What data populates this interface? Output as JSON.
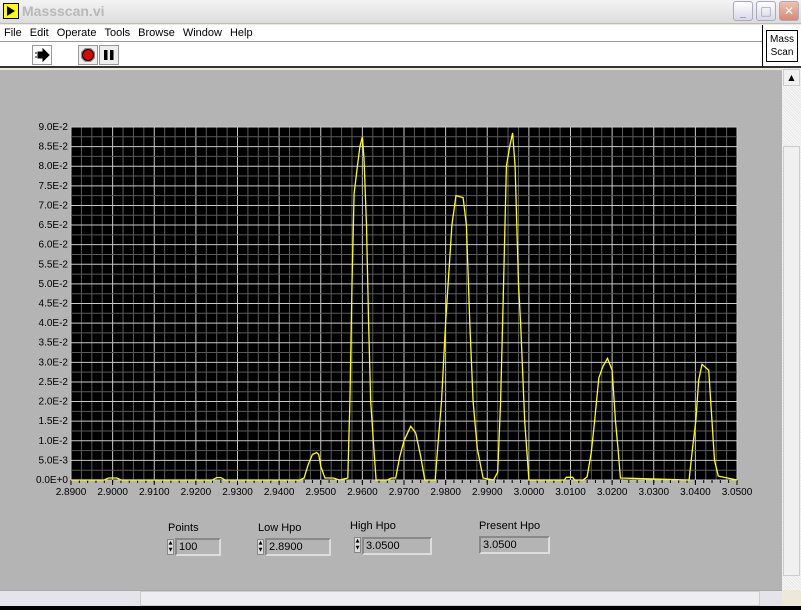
{
  "window": {
    "title": "Massscan.vi"
  },
  "menu": [
    "File",
    "Edit",
    "Operate",
    "Tools",
    "Browse",
    "Window",
    "Help"
  ],
  "toolbar": {
    "run_icon": "run-arrow-icon",
    "stop_icon": "abort-icon",
    "pause_icon": "pause-icon"
  },
  "vi_icon_label": [
    "Mass",
    "Scan"
  ],
  "controls": {
    "points": {
      "label": "Points",
      "value": "100"
    },
    "low_hpo": {
      "label": "Low Hpo",
      "value": "2.8900"
    },
    "high_hpo": {
      "label": "High Hpo",
      "value": "3.0500"
    },
    "present_hpo": {
      "label": "Present Hpo",
      "value": "3.0500"
    }
  },
  "colors": {
    "plot_bg": "#000000",
    "trace": "#ffff00",
    "panel": "#b4b4b4"
  },
  "chart_data": {
    "type": "line",
    "xlim": [
      2.89,
      3.05
    ],
    "ylim": [
      0,
      0.09
    ],
    "grid": true,
    "x_ticks": [
      "2.8900",
      "2.9000",
      "2.9100",
      "2.9200",
      "2.9300",
      "2.9400",
      "2.9500",
      "2.9600",
      "2.9700",
      "2.9800",
      "2.9900",
      "3.0000",
      "3.0100",
      "3.0200",
      "3.0300",
      "3.0400",
      "3.0500"
    ],
    "y_ticks": [
      "0.0E+0",
      "5.0E-3",
      "1.0E-2",
      "1.5E-2",
      "2.0E-2",
      "2.5E-2",
      "3.0E-2",
      "3.5E-2",
      "4.0E-2",
      "4.5E-2",
      "5.0E-2",
      "5.5E-2",
      "6.0E-2",
      "6.5E-2",
      "7.0E-2",
      "7.5E-2",
      "8.0E-2",
      "8.5E-2",
      "9.0E-2"
    ],
    "points": [
      [
        2.89,
        0
      ],
      [
        2.898,
        0
      ],
      [
        2.899,
        0.0005
      ],
      [
        2.901,
        0.0005
      ],
      [
        2.902,
        0
      ],
      [
        2.924,
        0
      ],
      [
        2.925,
        0.0006
      ],
      [
        2.926,
        0.0006
      ],
      [
        2.927,
        0
      ],
      [
        2.945,
        0
      ],
      [
        2.946,
        0.0005
      ],
      [
        2.947,
        0.004
      ],
      [
        2.948,
        0.0065
      ],
      [
        2.949,
        0.007
      ],
      [
        2.9495,
        0.0065
      ],
      [
        2.95,
        0.0035
      ],
      [
        2.951,
        0.0005
      ],
      [
        2.953,
        0.0005
      ],
      [
        2.9545,
        0
      ],
      [
        2.9565,
        0.0005
      ],
      [
        2.957,
        0.02
      ],
      [
        2.9575,
        0.05
      ],
      [
        2.958,
        0.073
      ],
      [
        2.9588,
        0.08
      ],
      [
        2.9594,
        0.085
      ],
      [
        2.96,
        0.0875
      ],
      [
        2.9604,
        0.082
      ],
      [
        2.961,
        0.065
      ],
      [
        2.9615,
        0.04
      ],
      [
        2.962,
        0.02
      ],
      [
        2.9628,
        0.0075
      ],
      [
        2.9633,
        0
      ],
      [
        2.966,
        0
      ],
      [
        2.967,
        0.0005
      ],
      [
        2.968,
        0.0005
      ],
      [
        2.969,
        0.006
      ],
      [
        2.97,
        0.01
      ],
      [
        2.9716,
        0.0137
      ],
      [
        2.9728,
        0.012
      ],
      [
        2.974,
        0.006
      ],
      [
        2.975,
        0
      ],
      [
        2.9775,
        0
      ],
      [
        2.978,
        0.007
      ],
      [
        2.979,
        0.02
      ],
      [
        2.98,
        0.04
      ],
      [
        2.9815,
        0.065
      ],
      [
        2.9825,
        0.0725
      ],
      [
        2.9842,
        0.072
      ],
      [
        2.985,
        0.065
      ],
      [
        2.9858,
        0.04
      ],
      [
        2.9866,
        0.02
      ],
      [
        2.9876,
        0.008
      ],
      [
        2.989,
        0.0005
      ],
      [
        2.9915,
        0
      ],
      [
        2.9925,
        0.002
      ],
      [
        2.9932,
        0.02
      ],
      [
        2.9938,
        0.045
      ],
      [
        2.9946,
        0.08
      ],
      [
        2.9954,
        0.085
      ],
      [
        2.9961,
        0.0885
      ],
      [
        2.9967,
        0.08
      ],
      [
        2.9975,
        0.05
      ],
      [
        2.998,
        0.04
      ],
      [
        2.999,
        0.015
      ],
      [
        3.0,
        0
      ],
      [
        3.0085,
        0
      ],
      [
        3.009,
        0.0007
      ],
      [
        3.0105,
        0.0007
      ],
      [
        3.011,
        0
      ],
      [
        3.013,
        0
      ],
      [
        3.014,
        0.0008
      ],
      [
        3.015,
        0.007
      ],
      [
        3.0158,
        0.015
      ],
      [
        3.0168,
        0.026
      ],
      [
        3.0178,
        0.029
      ],
      [
        3.0189,
        0.031
      ],
      [
        3.02,
        0.028
      ],
      [
        3.0208,
        0.015
      ],
      [
        3.0214,
        0.008
      ],
      [
        3.022,
        0.0005
      ],
      [
        3.0385,
        0
      ],
      [
        3.0393,
        0.008
      ],
      [
        3.0401,
        0.015
      ],
      [
        3.0408,
        0.0255
      ],
      [
        3.0416,
        0.0295
      ],
      [
        3.0432,
        0.028
      ],
      [
        3.044,
        0.015
      ],
      [
        3.0446,
        0.005
      ],
      [
        3.0455,
        0.001
      ],
      [
        3.05,
        0
      ]
    ]
  }
}
